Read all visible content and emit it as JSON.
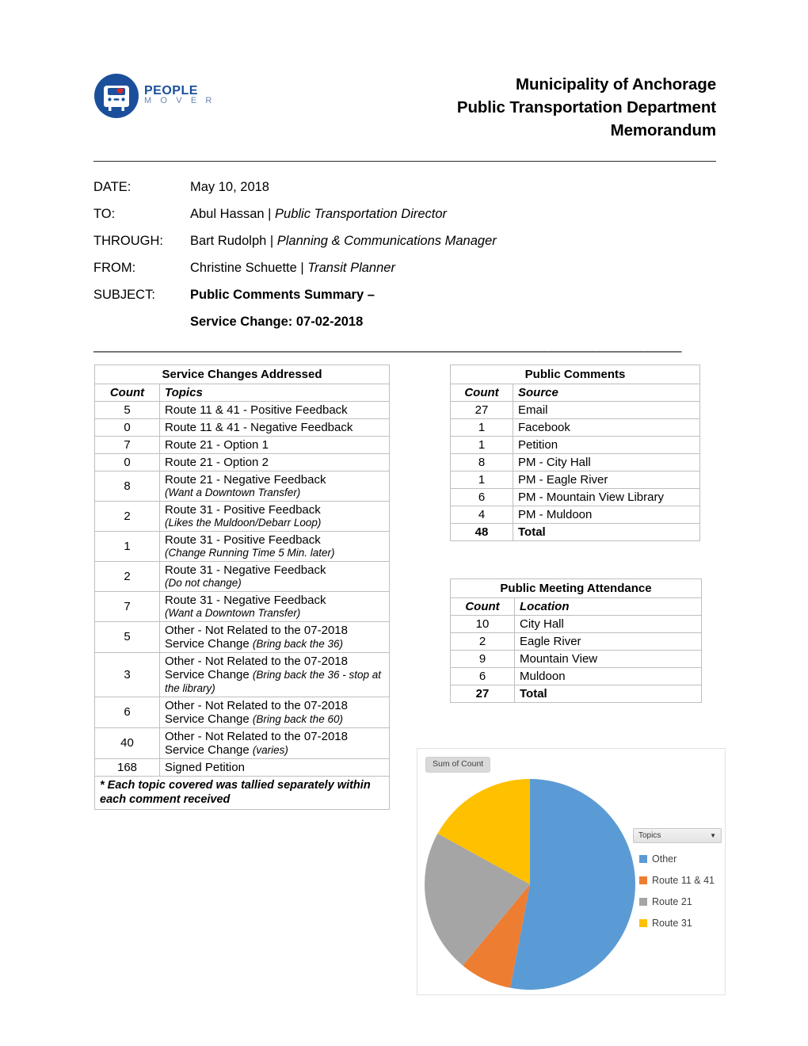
{
  "logo": {
    "word_top": "PEOPLE",
    "word_bottom": "M O V E R",
    "icon": "bus-in-circle-icon",
    "circle_color": "#1b4f9c",
    "heart_color": "#d42a2a"
  },
  "header": {
    "line1": "Municipality of Anchorage",
    "line2": "Public Transportation Department",
    "line3": "Memorandum"
  },
  "memo": {
    "date_label": "DATE:",
    "date_value": "May 10, 2018",
    "to_label": "TO:",
    "to_name": "Abul Hassan | ",
    "to_title": "Public Transportation Director",
    "through_label": "THROUGH:",
    "through_name": "Bart Rudolph | ",
    "through_title": "Planning & Communications Manager",
    "from_label": "FROM:",
    "from_name": "Christine Schuette | ",
    "from_title": "Transit Planner",
    "subject_label": "SUBJECT:",
    "subject_line1": "Public Comments Summary –",
    "subject_line2": "Service Change: 07-02-2018"
  },
  "divider": "______________________________________________________________________________________",
  "service_changes_table": {
    "caption": "Service Changes Addressed",
    "headers": [
      "Count",
      "Topics"
    ],
    "rows": [
      {
        "count": "5",
        "topic": "Route 11 & 41 - Positive Feedback",
        "note": ""
      },
      {
        "count": "0",
        "topic": "Route 11 & 41 - Negative Feedback",
        "note": ""
      },
      {
        "count": "7",
        "topic": "Route 21 - Option 1",
        "note": ""
      },
      {
        "count": "0",
        "topic": "Route 21 - Option 2",
        "note": ""
      },
      {
        "count": "8",
        "topic": "Route 21 - Negative Feedback",
        "note": "(Want a Downtown Transfer)"
      },
      {
        "count": "2",
        "topic": "Route 31 - Positive Feedback",
        "note": "(Likes the Muldoon/Debarr Loop)"
      },
      {
        "count": "1",
        "topic": "Route 31 - Positive Feedback",
        "note": "(Change Running Time 5 Min. later)"
      },
      {
        "count": "2",
        "topic": "Route 31 - Negative Feedback",
        "note": "(Do not change)"
      },
      {
        "count": "7",
        "topic": "Route 31 - Negative Feedback",
        "note": "(Want a Downtown Transfer)"
      },
      {
        "count": "5",
        "topic": "Other - Not Related to the 07-2018 Service Change ",
        "inline_note": "(Bring back the 36)",
        "note": ""
      },
      {
        "count": "3",
        "topic": "Other - Not Related to the 07-2018 Service Change ",
        "inline_note": "(Bring back the 36 - stop at the library)",
        "note": ""
      },
      {
        "count": "6",
        "topic": "Other - Not Related to the 07-2018 Service Change ",
        "inline_note": "(Bring back the 60)",
        "note": ""
      },
      {
        "count": "40",
        "topic": "Other - Not Related to the 07-2018 Service Change ",
        "inline_note": "(varies)",
        "note": ""
      },
      {
        "count": "168",
        "topic": "Signed Petition",
        "note": ""
      }
    ],
    "footnote": "* Each topic covered was tallied separately within each comment received"
  },
  "public_comments_table": {
    "caption": "Public Comments",
    "headers": [
      "Count",
      "Source"
    ],
    "rows": [
      {
        "count": "27",
        "source": "Email"
      },
      {
        "count": "1",
        "source": "Facebook"
      },
      {
        "count": "1",
        "source": "Petition"
      },
      {
        "count": "8",
        "source": "PM - City Hall"
      },
      {
        "count": "1",
        "source": "PM - Eagle River"
      },
      {
        "count": "6",
        "source": "PM - Mountain View Library"
      },
      {
        "count": "4",
        "source": "PM - Muldoon"
      }
    ],
    "total": {
      "count": "48",
      "source": "Total"
    }
  },
  "attendance_table": {
    "caption": "Public Meeting Attendance",
    "headers": [
      "Count",
      "Location"
    ],
    "rows": [
      {
        "count": "10",
        "location": "City Hall"
      },
      {
        "count": "2",
        "location": "Eagle River"
      },
      {
        "count": "9",
        "location": "Mountain View"
      },
      {
        "count": "6",
        "location": "Muldoon"
      }
    ],
    "total": {
      "count": "27",
      "location": "Total"
    }
  },
  "chart_panel": {
    "field_button": "Sum of Count",
    "legend_field_button": "Topics",
    "legend_caret": "▼"
  },
  "chart_data": {
    "type": "pie",
    "title": "Sum of Count",
    "legend_title": "Topics",
    "legend_position": "right",
    "start_angle_deg": 0,
    "direction": "clockwise",
    "categories": [
      "Other",
      "Route 11 & 41",
      "Route 21",
      "Route 31"
    ],
    "values": [
      53,
      8,
      22,
      17
    ],
    "value_unit": "percent",
    "colors": [
      "#5b9bd5",
      "#ed7d31",
      "#a5a5a5",
      "#ffc000"
    ]
  }
}
